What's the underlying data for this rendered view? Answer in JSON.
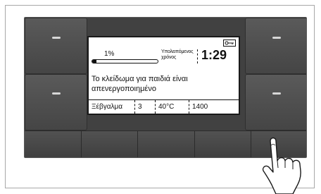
{
  "display": {
    "progress_text": "1%",
    "progress_value": 0.01,
    "remaining_label": "Υπολειπόμενος χρόνος",
    "remaining_time": "1:29",
    "message": "Το κλείδωμα για παιδιά είναι απενεργοποιημένο",
    "lock_icon": "key-lock-icon"
  },
  "settings": {
    "program": "Ξέβγαλμα",
    "rinses": "3",
    "temperature": "40°C",
    "spin": "1400"
  },
  "colors": {
    "panel": "#414141",
    "led": "#d7d7d7",
    "screen": "#ffffff"
  },
  "icons": [
    "key-lock-icon",
    "pointing-hand-icon"
  ]
}
